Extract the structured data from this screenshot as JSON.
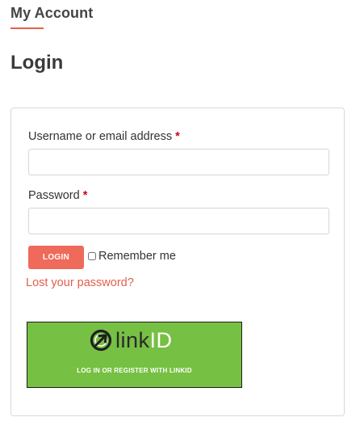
{
  "section": {
    "title": "My Account",
    "accent_color": "#e8604c"
  },
  "login": {
    "heading": "Login",
    "username_label": "Username or email address",
    "username_value": "",
    "password_label": "Password",
    "password_value": "",
    "required_marker": "*",
    "login_button_label": "LOGIN",
    "remember_label": "Remember me",
    "remember_checked": false,
    "lost_password_link": "Lost your password?",
    "button_color": "#ef6a5a",
    "link_color": "#e0604d"
  },
  "linkid": {
    "logo_text_dark": "link",
    "logo_text_light": "ID",
    "logo_icon": "linkid-circle-arrow-icon",
    "caption": "LOG IN OR REGISTER WITH LINKID",
    "background_color": "#76c043"
  }
}
